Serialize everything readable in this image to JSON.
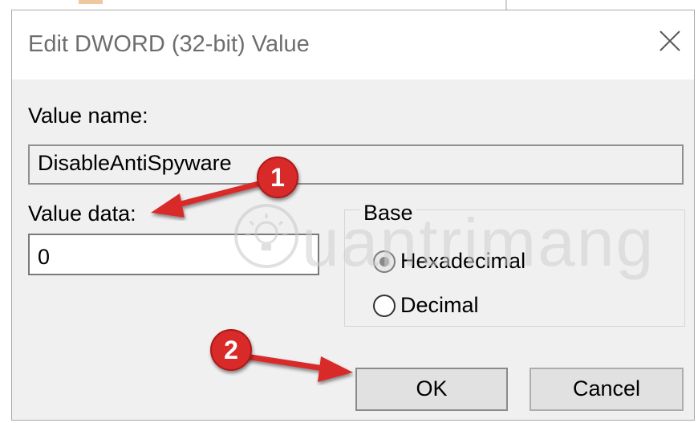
{
  "dialog": {
    "title": "Edit DWORD (32-bit) Value",
    "close_icon": "close-icon"
  },
  "form": {
    "value_name_label": "Value name:",
    "value_name": "DisableAntiSpyware",
    "value_data_label": "Value data:",
    "value_data": "0",
    "base": {
      "legend": "Base",
      "options": [
        {
          "label": "Hexadecimal",
          "checked": true
        },
        {
          "label": "Decimal",
          "checked": false
        }
      ]
    }
  },
  "buttons": {
    "ok": "OK",
    "cancel": "Cancel"
  },
  "annotations": {
    "step1": "1",
    "step2": "2",
    "color": "#d92a2a"
  },
  "watermark": {
    "text": "uantrimang",
    "icon": "lightbulb-icon"
  }
}
